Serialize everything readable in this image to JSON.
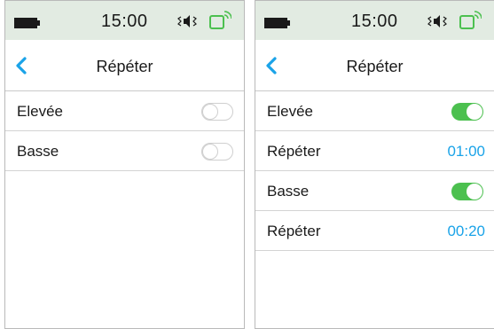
{
  "colors": {
    "statusbar_bg": "#e2ebe2",
    "accent": "#1aa3e8",
    "toggle_on": "#4cc04f",
    "wifi": "#4cc04f"
  },
  "screens": [
    {
      "status": {
        "time": "15:00",
        "icons": [
          "battery-icon",
          "speaker-vibrate-icon",
          "wifi-signal-icon"
        ]
      },
      "header": {
        "back_icon": "chevron-left-icon",
        "title": "Répéter"
      },
      "rows": [
        {
          "label": "Elevée",
          "type": "toggle",
          "on": false
        },
        {
          "label": "Basse",
          "type": "toggle",
          "on": false
        }
      ]
    },
    {
      "status": {
        "time": "15:00",
        "icons": [
          "battery-icon",
          "speaker-vibrate-icon",
          "wifi-signal-icon"
        ]
      },
      "header": {
        "back_icon": "chevron-left-icon",
        "title": "Répéter"
      },
      "rows": [
        {
          "label": "Elevée",
          "type": "toggle",
          "on": true
        },
        {
          "label": "Répéter",
          "type": "value",
          "value": "01:00"
        },
        {
          "label": "Basse",
          "type": "toggle",
          "on": true
        },
        {
          "label": "Répéter",
          "type": "value",
          "value": "00:20"
        }
      ]
    }
  ]
}
